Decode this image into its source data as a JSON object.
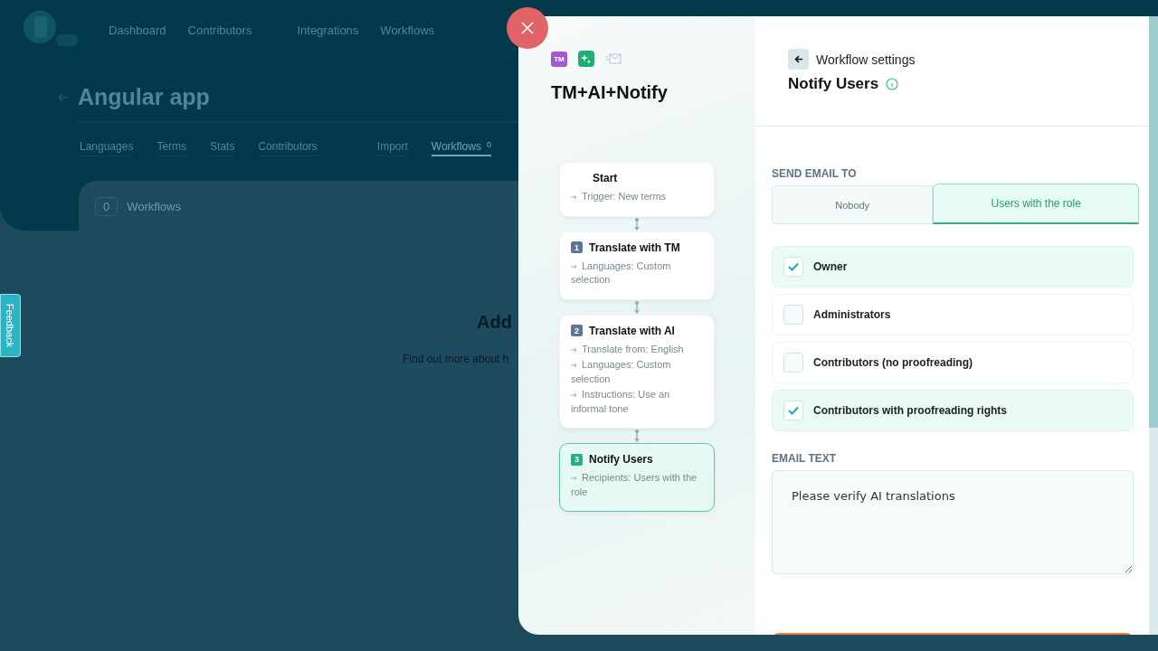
{
  "background": {
    "nav": [
      "Dashboard",
      "Contributors",
      "Integrations",
      "Workflows"
    ],
    "page_title": "Angular app",
    "tabs": [
      {
        "label": "Languages",
        "selected": false
      },
      {
        "label": "Terms",
        "selected": false
      },
      {
        "label": "Stats",
        "selected": false
      },
      {
        "label": "Contributors",
        "selected": false
      },
      {
        "label": "Import",
        "selected": false
      },
      {
        "label": "Workflows",
        "selected": true,
        "count": "0"
      }
    ],
    "workflows_count": "0",
    "workflows_label": "Workflows",
    "empty_title": "Add",
    "empty_text": "Find out more about h",
    "feedback": "Feedback"
  },
  "modal": {
    "badge": "TM",
    "workflow_title": "TM+AI+Notify",
    "steps": [
      {
        "title": "Start",
        "details": [
          "Trigger: New terms"
        ],
        "selected": false
      },
      {
        "number": "1",
        "title": "Translate with TM",
        "details": [
          "Languages: Custom selection"
        ],
        "selected": false
      },
      {
        "number": "2",
        "title": "Translate with AI",
        "details": [
          "Translate from: English",
          "Languages: Custom selection",
          "Instructions: Use an informal tone"
        ],
        "selected": false
      },
      {
        "number": "3",
        "title": "Notify Users",
        "details": [
          "Recipients: Users with the role"
        ],
        "selected": true
      }
    ],
    "settings": {
      "back_label": "Workflow settings",
      "title": "Notify Users",
      "send_label": "SEND EMAIL TO",
      "options": [
        {
          "label": "Nobody",
          "selected": false
        },
        {
          "label": "Users with the role",
          "selected": true
        }
      ],
      "roles": [
        {
          "label": "Owner",
          "checked": true
        },
        {
          "label": "Administrators",
          "checked": false
        },
        {
          "label": "Contributors (no proofreading)",
          "checked": false
        },
        {
          "label": "Contributors with proofreading rights",
          "checked": true
        }
      ],
      "email_label": "EMAIL TEXT",
      "email_text": "Please verify AI translations"
    }
  }
}
